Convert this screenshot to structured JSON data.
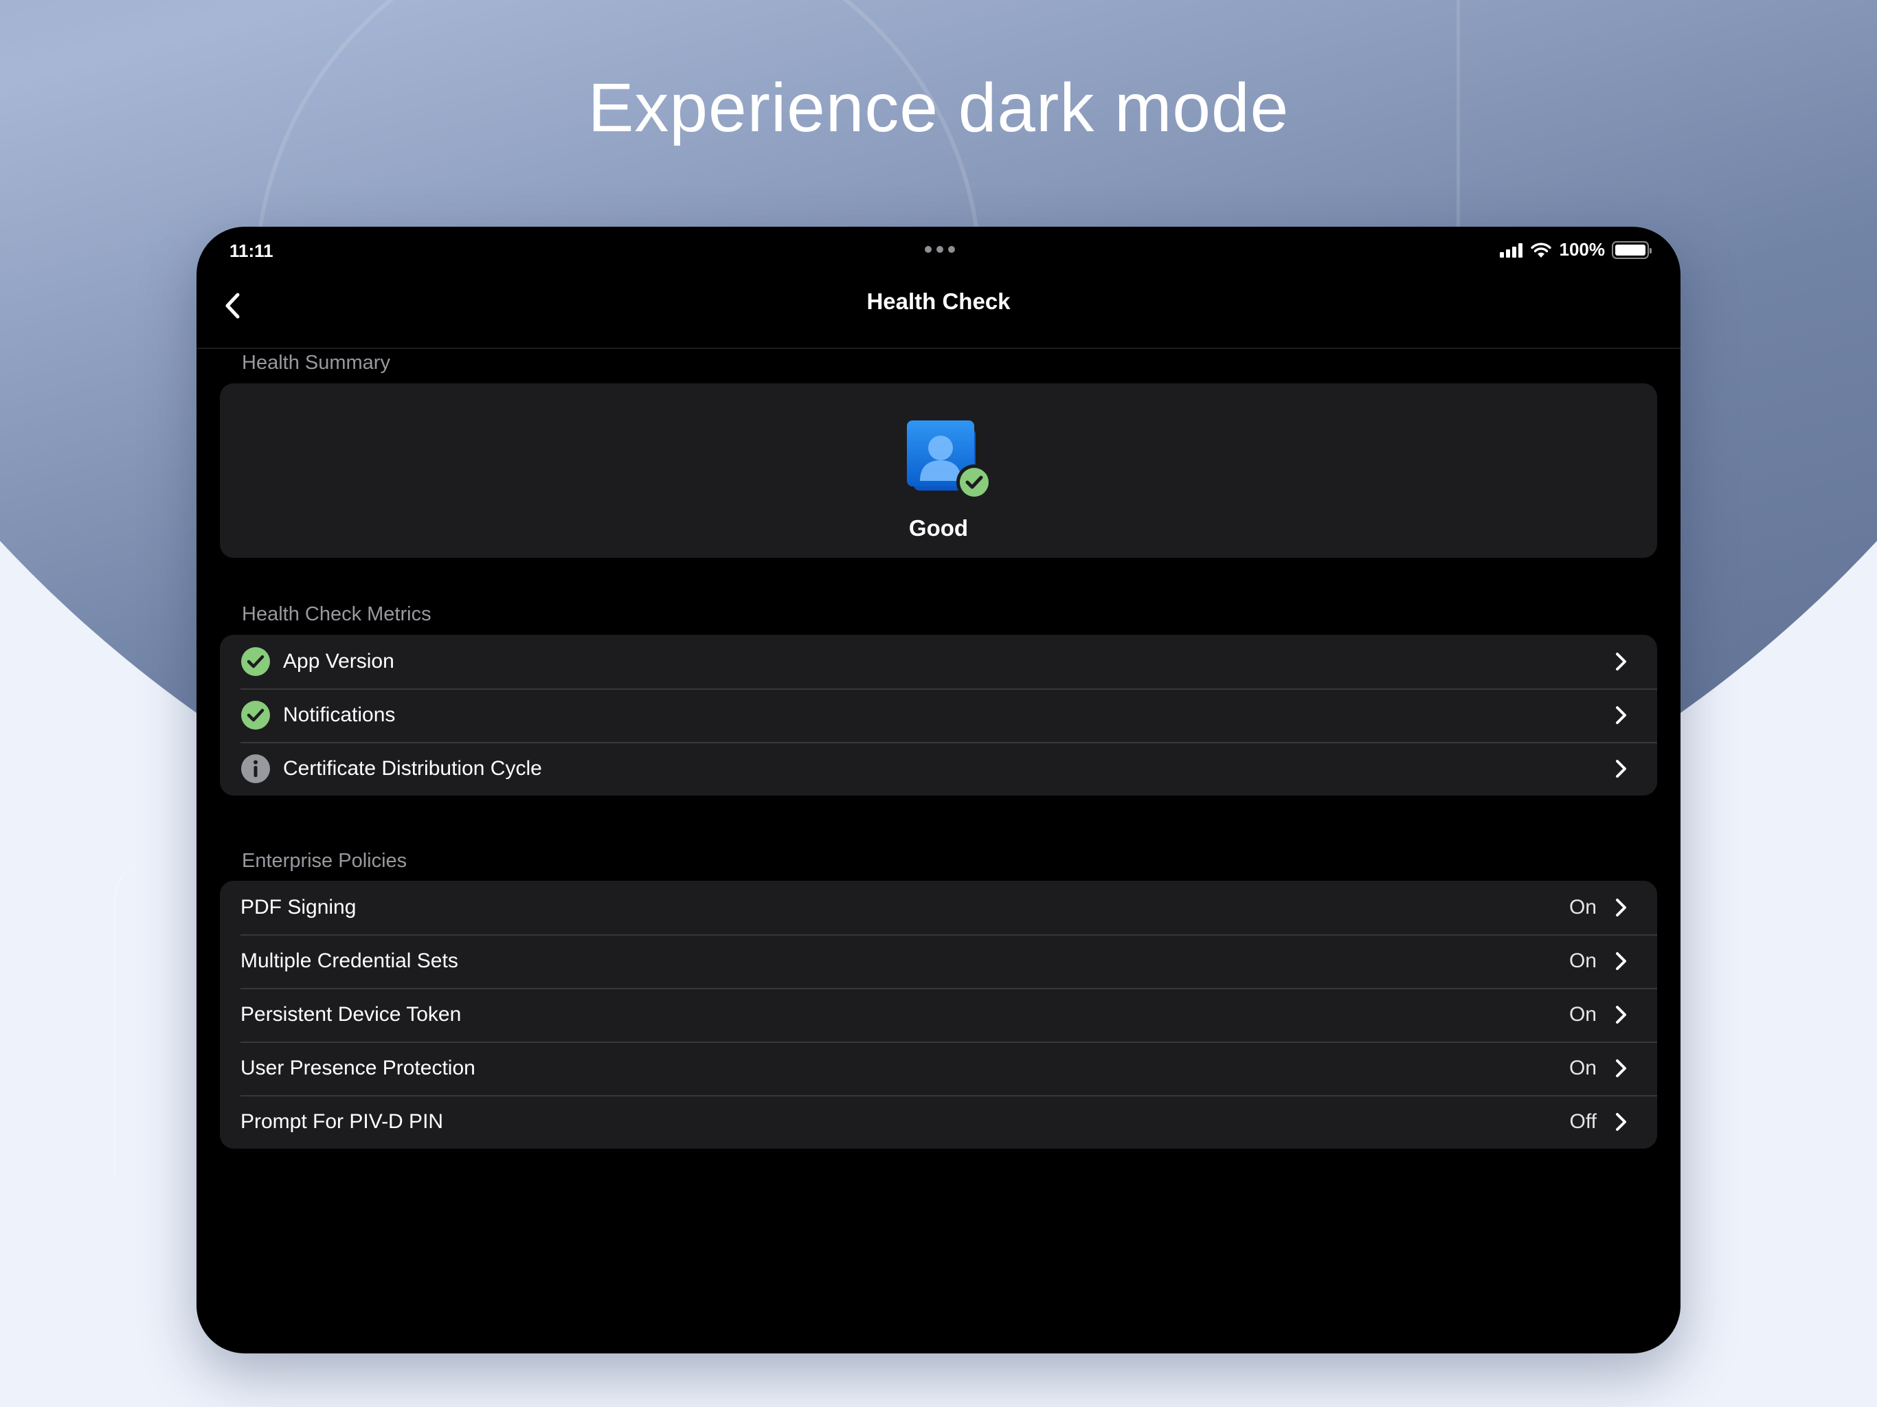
{
  "headline": "Experience dark mode",
  "status_bar": {
    "time": "11:11",
    "battery": "100%",
    "battery_level": 1.0
  },
  "nav": {
    "title": "Health Check",
    "back_icon": "chevron-left-icon"
  },
  "summary": {
    "header": "Health Summary",
    "status": "Good",
    "icon": "profile-check-icon"
  },
  "metrics": {
    "header": "Health Check Metrics",
    "items": [
      {
        "label": "App Version",
        "icon": "check-circle-icon"
      },
      {
        "label": "Notifications",
        "icon": "check-circle-icon"
      },
      {
        "label": "Certificate Distribution Cycle",
        "icon": "info-circle-icon"
      }
    ]
  },
  "policies": {
    "header": "Enterprise Policies",
    "items": [
      {
        "label": "PDF Signing",
        "value": "On"
      },
      {
        "label": "Multiple Credential Sets",
        "value": "On"
      },
      {
        "label": "Persistent Device Token",
        "value": "On"
      },
      {
        "label": "User Presence Protection",
        "value": "On"
      },
      {
        "label": "Prompt For PIV-D PIN",
        "value": "Off"
      }
    ]
  },
  "colors": {
    "success": "#88cc7c",
    "info": "#98989f",
    "card": "#1c1c1e",
    "accent_blue": "#1f8ef1"
  }
}
